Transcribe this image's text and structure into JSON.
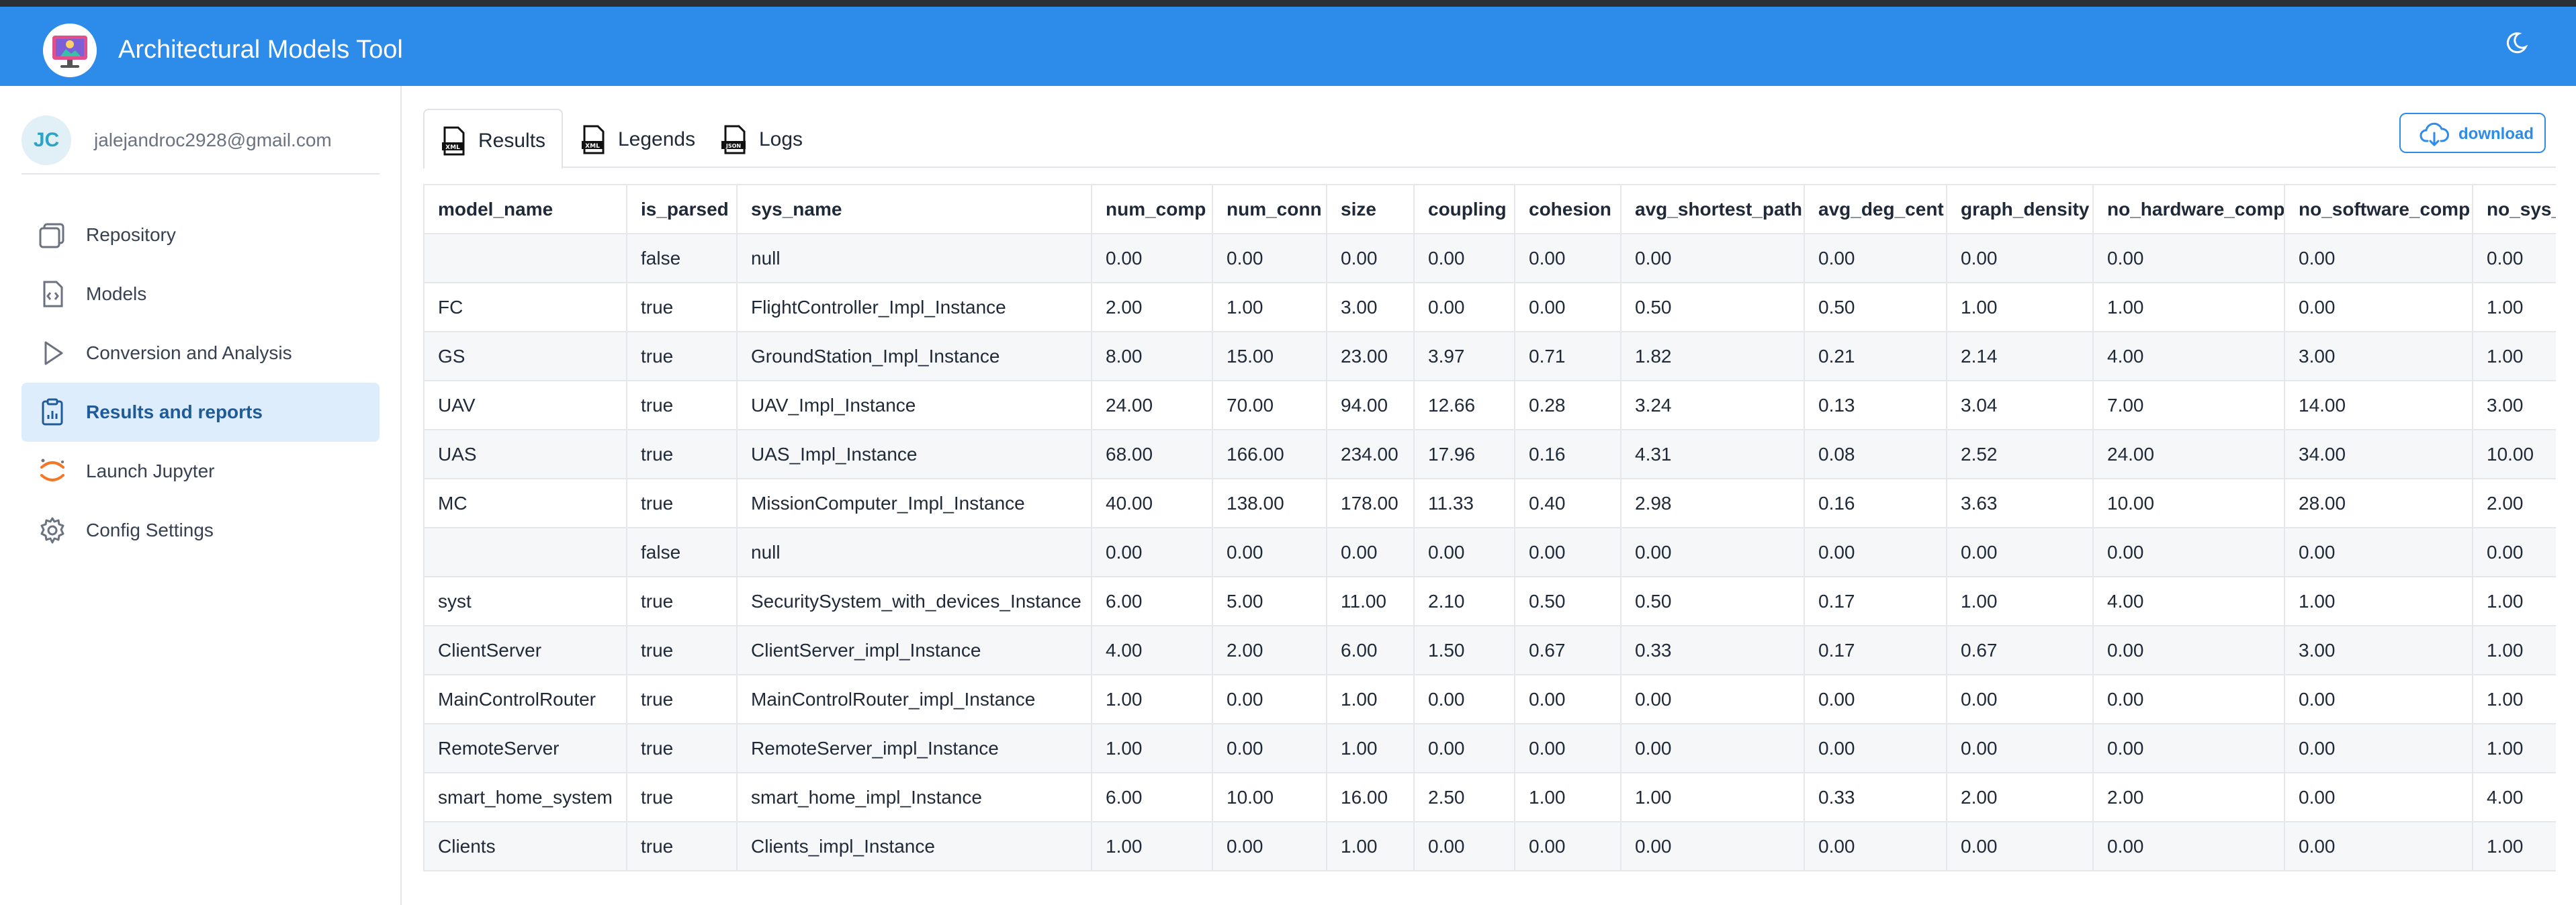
{
  "app": {
    "title": "Architectural Models Tool",
    "brand_color": "#2d8cea"
  },
  "user": {
    "initials": "JC",
    "email": "jalejandroc2928@gmail.com"
  },
  "sidebar": {
    "items": [
      {
        "label": "Repository",
        "icon": "folders-icon",
        "active": false
      },
      {
        "label": "Models",
        "icon": "code-file-icon",
        "active": false
      },
      {
        "label": "Conversion and Analysis",
        "icon": "play-icon",
        "active": false
      },
      {
        "label": "Results and reports",
        "icon": "clipboard-chart-icon",
        "active": true
      },
      {
        "label": "Launch Jupyter",
        "icon": "jupyter-icon",
        "active": false
      },
      {
        "label": "Config Settings",
        "icon": "gear-icon",
        "active": false
      }
    ]
  },
  "tabs": [
    {
      "label": "Results",
      "icon": "xml-file-icon",
      "badge": "XML",
      "active": true
    },
    {
      "label": "Legends",
      "icon": "xml-file-icon",
      "badge": "XML",
      "active": false
    },
    {
      "label": "Logs",
      "icon": "json-file-icon",
      "badge": "JSON",
      "active": false
    }
  ],
  "download": {
    "label": "download"
  },
  "table": {
    "columns": [
      "model_name",
      "is_parsed",
      "sys_name",
      "num_comp",
      "num_conn",
      "size",
      "coupling",
      "cohesion",
      "avg_shortest_path",
      "avg_deg_cent",
      "graph_density",
      "no_hardware_comp",
      "no_software_comp",
      "no_sys_comp"
    ],
    "rows": [
      [
        "",
        "false",
        "null",
        "0.00",
        "0.00",
        "0.00",
        "0.00",
        "0.00",
        "0.00",
        "0.00",
        "0.00",
        "0.00",
        "0.00",
        "0.00"
      ],
      [
        "FC",
        "true",
        "FlightController_Impl_Instance",
        "2.00",
        "1.00",
        "3.00",
        "0.00",
        "0.00",
        "0.50",
        "0.50",
        "1.00",
        "1.00",
        "0.00",
        "1.00"
      ],
      [
        "GS",
        "true",
        "GroundStation_Impl_Instance",
        "8.00",
        "15.00",
        "23.00",
        "3.97",
        "0.71",
        "1.82",
        "0.21",
        "2.14",
        "4.00",
        "3.00",
        "1.00"
      ],
      [
        "UAV",
        "true",
        "UAV_Impl_Instance",
        "24.00",
        "70.00",
        "94.00",
        "12.66",
        "0.28",
        "3.24",
        "0.13",
        "3.04",
        "7.00",
        "14.00",
        "3.00"
      ],
      [
        "UAS",
        "true",
        "UAS_Impl_Instance",
        "68.00",
        "166.00",
        "234.00",
        "17.96",
        "0.16",
        "4.31",
        "0.08",
        "2.52",
        "24.00",
        "34.00",
        "10.00"
      ],
      [
        "MC",
        "true",
        "MissionComputer_Impl_Instance",
        "40.00",
        "138.00",
        "178.00",
        "11.33",
        "0.40",
        "2.98",
        "0.16",
        "3.63",
        "10.00",
        "28.00",
        "2.00"
      ],
      [
        "",
        "false",
        "null",
        "0.00",
        "0.00",
        "0.00",
        "0.00",
        "0.00",
        "0.00",
        "0.00",
        "0.00",
        "0.00",
        "0.00",
        "0.00"
      ],
      [
        "syst",
        "true",
        "SecuritySystem_with_devices_Instance",
        "6.00",
        "5.00",
        "11.00",
        "2.10",
        "0.50",
        "0.50",
        "0.17",
        "1.00",
        "4.00",
        "1.00",
        "1.00"
      ],
      [
        "ClientServer",
        "true",
        "ClientServer_impl_Instance",
        "4.00",
        "2.00",
        "6.00",
        "1.50",
        "0.67",
        "0.33",
        "0.17",
        "0.67",
        "0.00",
        "3.00",
        "1.00"
      ],
      [
        "MainControlRouter",
        "true",
        "MainControlRouter_impl_Instance",
        "1.00",
        "0.00",
        "1.00",
        "0.00",
        "0.00",
        "0.00",
        "0.00",
        "0.00",
        "0.00",
        "0.00",
        "1.00"
      ],
      [
        "RemoteServer",
        "true",
        "RemoteServer_impl_Instance",
        "1.00",
        "0.00",
        "1.00",
        "0.00",
        "0.00",
        "0.00",
        "0.00",
        "0.00",
        "0.00",
        "0.00",
        "1.00"
      ],
      [
        "smart_home_system",
        "true",
        "smart_home_impl_Instance",
        "6.00",
        "10.00",
        "16.00",
        "2.50",
        "1.00",
        "1.00",
        "0.33",
        "2.00",
        "2.00",
        "0.00",
        "4.00"
      ],
      [
        "Clients",
        "true",
        "Clients_impl_Instance",
        "1.00",
        "0.00",
        "1.00",
        "0.00",
        "0.00",
        "0.00",
        "0.00",
        "0.00",
        "0.00",
        "0.00",
        "1.00"
      ]
    ]
  }
}
